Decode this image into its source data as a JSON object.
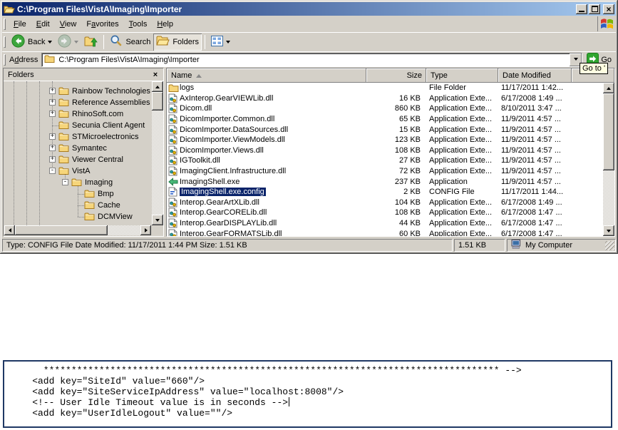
{
  "colors": {
    "titlebar_left": "#0a246a",
    "titlebar_right": "#a6caf0",
    "selection": "#0a246a",
    "chrome": "#d4d0c8",
    "tooltip_bg": "#ffffe1",
    "code_border": "#1f3864",
    "go_green": "#2fa52f"
  },
  "window": {
    "title": "C:\\Program Files\\VistA\\Imaging\\Importer"
  },
  "menu_bar": {
    "items": [
      {
        "label": "File",
        "u": 0
      },
      {
        "label": "Edit",
        "u": 0
      },
      {
        "label": "View",
        "u": 0
      },
      {
        "label": "Favorites",
        "u": 1
      },
      {
        "label": "Tools",
        "u": 0
      },
      {
        "label": "Help",
        "u": 0
      }
    ]
  },
  "toolbar": {
    "back": "Back",
    "search": "Search",
    "folders": "Folders"
  },
  "address_bar": {
    "label": "Address",
    "u": 1,
    "path": "C:\\Program Files\\VistA\\Imaging\\Importer",
    "go": "Go"
  },
  "tooltip": "Go to '",
  "folders_panel": {
    "title": "Folders",
    "tree": [
      {
        "label": "Rainbow Technologies",
        "depth": 4,
        "toggle": "plus"
      },
      {
        "label": "Reference Assemblies",
        "depth": 4,
        "toggle": "plus"
      },
      {
        "label": "RhinoSoft.com",
        "depth": 4,
        "toggle": "plus"
      },
      {
        "label": "Secunia Client Agent",
        "depth": 4,
        "toggle": "none"
      },
      {
        "label": "STMicroelectronics",
        "depth": 4,
        "toggle": "plus"
      },
      {
        "label": "Symantec",
        "depth": 4,
        "toggle": "plus"
      },
      {
        "label": "Viewer Central",
        "depth": 4,
        "toggle": "plus"
      },
      {
        "label": "VistA",
        "depth": 4,
        "toggle": "minus"
      },
      {
        "label": "Imaging",
        "depth": 5,
        "toggle": "minus"
      },
      {
        "label": "Bmp",
        "depth": 6,
        "toggle": "none"
      },
      {
        "label": "Cache",
        "depth": 6,
        "toggle": "none"
      },
      {
        "label": "DCMView",
        "depth": 6,
        "toggle": "none"
      }
    ]
  },
  "file_list": {
    "columns": [
      "Name",
      "Size",
      "Type",
      "Date Modified"
    ],
    "rows": [
      {
        "name": "logs",
        "size": "",
        "type": "File Folder",
        "date": "11/17/2011 1:42...",
        "icon": "folder",
        "selected": false
      },
      {
        "name": "AxInterop.GearVIEWLib.dll",
        "size": "16 KB",
        "type": "Application Exte...",
        "date": "6/17/2008 1:49 ...",
        "icon": "dll",
        "selected": false
      },
      {
        "name": "Dicom.dll",
        "size": "860 KB",
        "type": "Application Exte...",
        "date": "8/10/2011 3:47 ...",
        "icon": "dll",
        "selected": false
      },
      {
        "name": "DicomImporter.Common.dll",
        "size": "65 KB",
        "type": "Application Exte...",
        "date": "11/9/2011 4:57 ...",
        "icon": "dll",
        "selected": false
      },
      {
        "name": "DicomImporter.DataSources.dll",
        "size": "15 KB",
        "type": "Application Exte...",
        "date": "11/9/2011 4:57 ...",
        "icon": "dll",
        "selected": false
      },
      {
        "name": "DicomImporter.ViewModels.dll",
        "size": "123 KB",
        "type": "Application Exte...",
        "date": "11/9/2011 4:57 ...",
        "icon": "dll",
        "selected": false
      },
      {
        "name": "DicomImporter.Views.dll",
        "size": "108 KB",
        "type": "Application Exte...",
        "date": "11/9/2011 4:57 ...",
        "icon": "dll",
        "selected": false
      },
      {
        "name": "IGToolkit.dll",
        "size": "27 KB",
        "type": "Application Exte...",
        "date": "11/9/2011 4:57 ...",
        "icon": "dll",
        "selected": false
      },
      {
        "name": "ImagingClient.Infrastructure.dll",
        "size": "72 KB",
        "type": "Application Exte...",
        "date": "11/9/2011 4:57 ...",
        "icon": "dll",
        "selected": false
      },
      {
        "name": "ImagingShell.exe",
        "size": "237 KB",
        "type": "Application",
        "date": "11/9/2011 4:57 ...",
        "icon": "exe",
        "selected": false
      },
      {
        "name": "ImagingShell.exe.config",
        "size": "2 KB",
        "type": "CONFIG File",
        "date": "11/17/2011 1:44...",
        "icon": "config",
        "selected": true
      },
      {
        "name": "Interop.GearArtXLib.dll",
        "size": "104 KB",
        "type": "Application Exte...",
        "date": "6/17/2008 1:49 ...",
        "icon": "dll",
        "selected": false
      },
      {
        "name": "Interop.GearCORELib.dll",
        "size": "108 KB",
        "type": "Application Exte...",
        "date": "6/17/2008 1:47 ...",
        "icon": "dll",
        "selected": false
      },
      {
        "name": "Interop.GearDISPLAYLib.dll",
        "size": "44 KB",
        "type": "Application Exte...",
        "date": "6/17/2008 1:47 ...",
        "icon": "dll",
        "selected": false
      },
      {
        "name": "Interop.GearFORMATSLib.dll",
        "size": "60 KB",
        "type": "Application Exte...",
        "date": "6/17/2008 1:47 ...",
        "icon": "dll",
        "selected": false
      }
    ]
  },
  "status_bar": {
    "left": "Type: CONFIG File Date Modified: 11/17/2011 1:44 PM Size: 1.51 KB",
    "size": "1.51 KB",
    "zone": "My Computer"
  },
  "code_box": {
    "lines": [
      {
        "text": "      ********************************************************************************** -->",
        "caret": false
      },
      {
        "text": "    <add key=\"SiteId\" value=\"660\"/>",
        "caret": false
      },
      {
        "text": "    <add key=\"SiteServiceIpAddress\" value=\"localhost:8008\"/>",
        "caret": false
      },
      {
        "text": "    <!-- User Idle Timeout value is in seconds -->",
        "caret": true
      },
      {
        "text": "    <add key=\"UserIdleLogout\" value=\"\"/>",
        "caret": false
      }
    ]
  }
}
